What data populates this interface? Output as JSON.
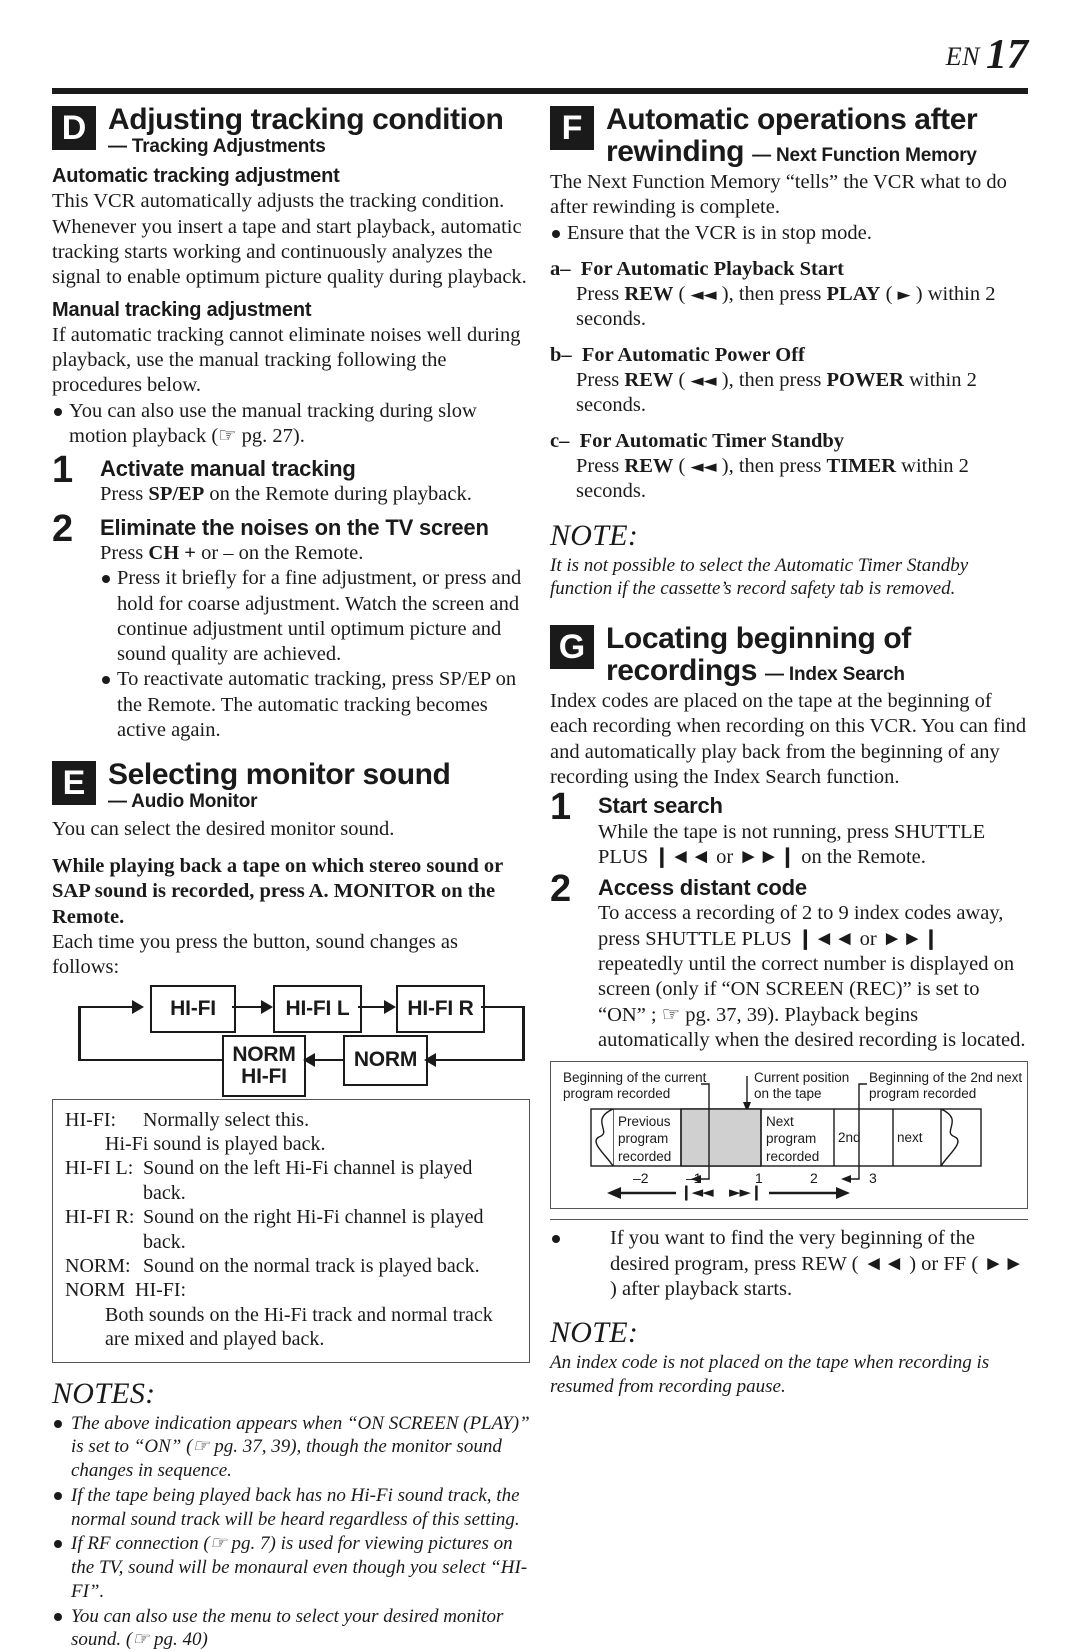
{
  "header": {
    "en_label": "EN",
    "page_number": "17"
  },
  "left_column": {
    "section_d": {
      "badge": "D",
      "title": "Adjusting tracking condition",
      "subtitle": "— Tracking Adjustments",
      "auto_heading": "Automatic tracking adjustment",
      "auto_text": "This VCR automatically adjusts the tracking condition. Whenever you insert a tape and start playback, automatic tracking starts working and continuously analyzes the signal to enable optimum picture quality during playback.",
      "manual_heading": "Manual tracking adjustment",
      "manual_text": "If automatic tracking cannot eliminate noises well during playback, use the manual tracking following the procedures below.",
      "manual_bullet": "You can also use the manual tracking during slow motion playback (☞ pg. 27).",
      "steps": [
        {
          "number": "1",
          "heading": "Activate manual tracking",
          "text_pre": "Press ",
          "text_key": "SP/EP",
          "text_post": " on the Remote during playback.",
          "bullets": []
        },
        {
          "number": "2",
          "heading": "Eliminate the noises on the TV screen",
          "text_pre": "Press ",
          "text_key": "CH +",
          "text_post": " or – on the Remote.",
          "bullets": [
            "Press it briefly for a fine adjustment, or press and hold for coarse adjustment. Watch the screen and continue adjustment until optimum picture and sound quality are achieved.",
            "To reactivate automatic tracking, press SP/EP on the Remote. The automatic tracking becomes active again."
          ]
        }
      ]
    },
    "section_e": {
      "badge": "E",
      "title": "Selecting monitor sound",
      "subtitle": "— Audio Monitor",
      "intro": "You can select the desired monitor sound.",
      "bold_instruction": "While playing back a tape on which stereo sound or SAP sound is recorded, press A. MONITOR on the Remote.",
      "follow_text": "Each time you press the button, sound changes as follows:",
      "flow_boxes": [
        "HI-FI",
        "HI-FI L",
        "HI-FI R",
        "NORM",
        "NORM\nHI-FI"
      ],
      "legend": [
        {
          "key": "HI-FI:",
          "value": "Normally select this.",
          "value2": "Hi-Fi sound is played back."
        },
        {
          "key": "HI-FI L:",
          "value": "Sound on the left Hi-Fi channel is played back."
        },
        {
          "key": "HI-FI R:",
          "value": "Sound on the right Hi-Fi channel is played back."
        },
        {
          "key": "NORM:",
          "value": "Sound on the normal track is played back."
        },
        {
          "key": "NORM  HI-FI:",
          "value": "",
          "value2": "Both sounds on the Hi-Fi track and normal track are mixed and played back."
        }
      ],
      "notes_heading": "NOTES:",
      "notes": [
        "The above indication appears when “ON SCREEN (PLAY)” is set to “ON” (☞ pg. 37, 39), though the monitor sound changes in sequence.",
        "If the tape being played back has no Hi-Fi sound track, the normal sound track will be heard regardless of this setting.",
        "If RF connection (☞ pg. 7) is used for viewing pictures on the TV, sound will be monaural even though you select “HI-FI”.",
        "You can also use the menu to select your desired monitor sound. (☞ pg. 40)"
      ]
    }
  },
  "right_column": {
    "section_f": {
      "badge": "F",
      "title_line1": "Automatic operations after",
      "title_line2": "rewinding",
      "subtitle": "— Next Function Memory",
      "intro": "The Next Function Memory “tells” the VCR what to do after rewinding is complete.",
      "bullet": "Ensure that the VCR is in stop mode.",
      "items": [
        {
          "label": "a–",
          "heading": "For Automatic Playback Start",
          "body_pre": "Press ",
          "key1": "REW",
          "sym1": "◄◄",
          "mid": ", then press ",
          "key2": "PLAY",
          "sym2": "►",
          "body_post": " within 2 seconds."
        },
        {
          "label": "b–",
          "heading": "For Automatic Power Off",
          "body_pre": "Press ",
          "key1": "REW",
          "sym1": "◄◄",
          "mid": ", then press ",
          "key2": "POWER",
          "sym2": "",
          "body_post": " within 2 seconds."
        },
        {
          "label": "c–",
          "heading": "For Automatic Timer Standby",
          "body_pre": "Press ",
          "key1": "REW",
          "sym1": "◄◄",
          "mid": ", then press ",
          "key2": "TIMER",
          "sym2": "",
          "body_post": " within 2 seconds."
        }
      ],
      "note_heading": "NOTE:",
      "note_text": "It is not possible to select the Automatic Timer Standby function if the cassette’s record safety tab is removed."
    },
    "section_g": {
      "badge": "G",
      "title_line1": "Locating beginning of",
      "title_line2": "recordings",
      "subtitle": "— Index Search",
      "intro": "Index codes are placed on the tape at the beginning of each recording when recording on this VCR. You can find and automatically play back from the beginning of any recording using the Index Search function.",
      "steps": [
        {
          "number": "1",
          "heading": "Start search",
          "body": "While the tape is not running, press SHUTTLE PLUS ❙◄◄ or ►►❙ on the Remote."
        },
        {
          "number": "2",
          "heading": "Access distant code",
          "body": "To access a recording of 2 to 9 index codes away, press SHUTTLE PLUS ❙◄◄ or ►►❙ repeatedly until the correct number is displayed on screen (only if “ON SCREEN (REC)” is set to “ON” ; ☞ pg. 37, 39). Playback begins automatically when the desired recording is located."
        }
      ],
      "diagram": {
        "label_left": "Beginning of the current\nprogram recorded",
        "label_center": "Current position\non the tape",
        "label_right": "Beginning of the 2nd next\nprogram recorded",
        "segments": [
          "Previous\nprogram\nrecorded",
          "",
          "Next\nprogram\nrecorded",
          "2nd",
          "next"
        ],
        "ticks": [
          "–2",
          "–1",
          "1",
          "2",
          "3"
        ],
        "arrow_back_label": "❙◄◄",
        "arrow_fwd_label": "►►❙"
      },
      "bullet": "If you want to find the very beginning of the desired program, press REW ( ◄◄ ) or FF ( ►► ) after playback starts.",
      "note_heading": "NOTE:",
      "note_text": "An index code is not placed on the tape when recording is resumed from recording pause."
    }
  }
}
